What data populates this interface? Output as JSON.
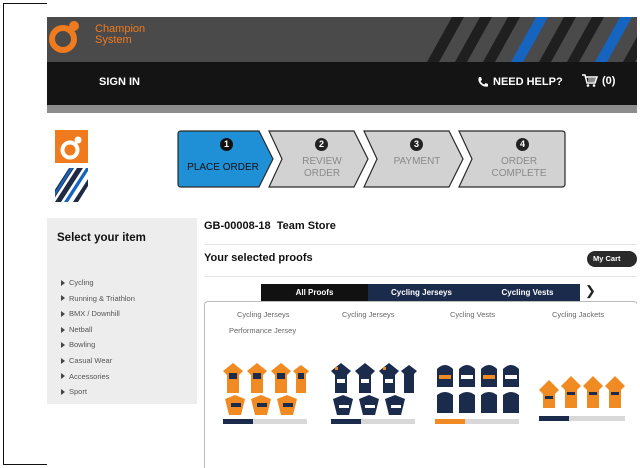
{
  "brand": {
    "name_line1": "Champion",
    "name_line2": "System"
  },
  "nav": {
    "sign_in": "SIGN IN",
    "need_help": "NEED HELP?",
    "cart": "(0)"
  },
  "steps": [
    {
      "number": "1",
      "label_line1": "PLACE ORDER",
      "label_line2": "",
      "active": true
    },
    {
      "number": "2",
      "label_line1": "REVIEW",
      "label_line2": "ORDER",
      "active": false
    },
    {
      "number": "3",
      "label_line1": "PAYMENT",
      "label_line2": "",
      "active": false
    },
    {
      "number": "4",
      "label_line1": "ORDER",
      "label_line2": "COMPLETE",
      "active": false
    }
  ],
  "sidebar": {
    "title": "Select your item",
    "items": [
      {
        "label": "Cycling"
      },
      {
        "label": "Running & Triathlon"
      },
      {
        "label": "BMX / Downhill"
      },
      {
        "label": "Netball"
      },
      {
        "label": "Bowling"
      },
      {
        "label": "Casual Wear"
      },
      {
        "label": "Accessories"
      },
      {
        "label": "Sport"
      }
    ]
  },
  "main": {
    "store_id": "GB-00008-18",
    "store_name": "Team Store",
    "proofs_title": "Your selected proofs",
    "my_cart_button": "My Cart (0)",
    "tabs": [
      {
        "label": "All Proofs",
        "active": true
      },
      {
        "label": "Cycling Jerseys",
        "active": false
      },
      {
        "label": "Cycling Vests",
        "active": false
      }
    ],
    "tabs_next_icon": "chevron-right-icon",
    "products": [
      {
        "label_line1": "Cycling Jerseys",
        "label_line2": "Performance Jersey"
      },
      {
        "label_line1": "Cycling Jerseys",
        "label_line2": ""
      },
      {
        "label_line1": "Cycling Vests",
        "label_line2": ""
      },
      {
        "label_line1": "Cycling Jackets",
        "label_line2": ""
      }
    ]
  },
  "colors": {
    "brand_orange": "#f07a1e",
    "active_step_blue": "#1f8fd6",
    "inactive_step_grey": "#d2d2d2",
    "navbar_black": "#141414",
    "tab_active_black": "#111111",
    "tab_navy": "#1b2b4c",
    "stripe_blue": "#1565c0"
  }
}
